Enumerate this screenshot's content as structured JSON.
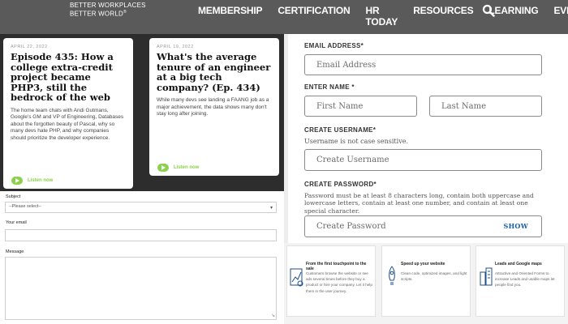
{
  "brand": {
    "line1": "Better Workplaces",
    "line2": "Better World",
    "mark": "®"
  },
  "nav": {
    "items": [
      "MEMBERSHIP",
      "CERTIFICATION",
      "HR TODAY",
      "RESOURCES",
      "LEARNING",
      "EVENTS"
    ],
    "search_icon": "search-icon"
  },
  "cards": [
    {
      "date": "APRIL 22, 2022",
      "title": "Episode 435: How a college extra-credit project became PHP3, still the bedrock of the web",
      "body": "The home team chats with Andi Gutmans, Google's GM and VP of Engineering, Databases about the forgotten beauty of Pascal, why so many devs hate PHP, and why companies should prioritize the developer experience.",
      "listen": "Listen now"
    },
    {
      "date": "APRIL 19, 2022",
      "title": "What's the average tenure of an engineer at a big tech company? (Ep. 434)",
      "body": "While many devs see landing a FAANG job as a major achievement, the data shows many don't stay long after joining.",
      "listen": "Listen now"
    }
  ],
  "contact_form": {
    "subject_label": "Subject",
    "subject_value": "--Please select--",
    "email_label": "Your email",
    "message_label": "Message"
  },
  "signup": {
    "email_label": "EMAIL ADDRESS*",
    "email_placeholder": "Email Address",
    "name_label": "ENTER NAME *",
    "first_placeholder": "First Name",
    "last_placeholder": "Last Name",
    "username_label": "CREATE USERNAME*",
    "username_hint": "Username is not case sensitive.",
    "username_placeholder": "Create Username",
    "password_label": "CREATE PASSWORD*",
    "password_hint": "Password must be at least 8 characters long, contain both uppercase and lowercase letters, contain at least one number, and contain at least one special character.",
    "password_placeholder": "Create Password",
    "show_label": "SHOW"
  },
  "features": [
    {
      "title": "From the first touchpoint to the sale",
      "text": "Customers browse the website or see ads several times before they buy a product or hire your company. Let it help them in the user journey.",
      "icon": "funnel-chart-icon"
    },
    {
      "title": "Speed up your website",
      "text": "Clean code, optimized images, and light scripts.",
      "icon": "rocket-icon"
    },
    {
      "title": "Leads and Google maps",
      "text": "Attractive and Oriented Forms to increase Leads and usable maps let people find you.",
      "icon": "building-map-icon"
    }
  ],
  "colors": {
    "nav_bg": "#5a5a5a",
    "listen_green": "#8cd14b",
    "show_blue": "#1a5fa6",
    "cards_bg": "#2d2d2d"
  }
}
